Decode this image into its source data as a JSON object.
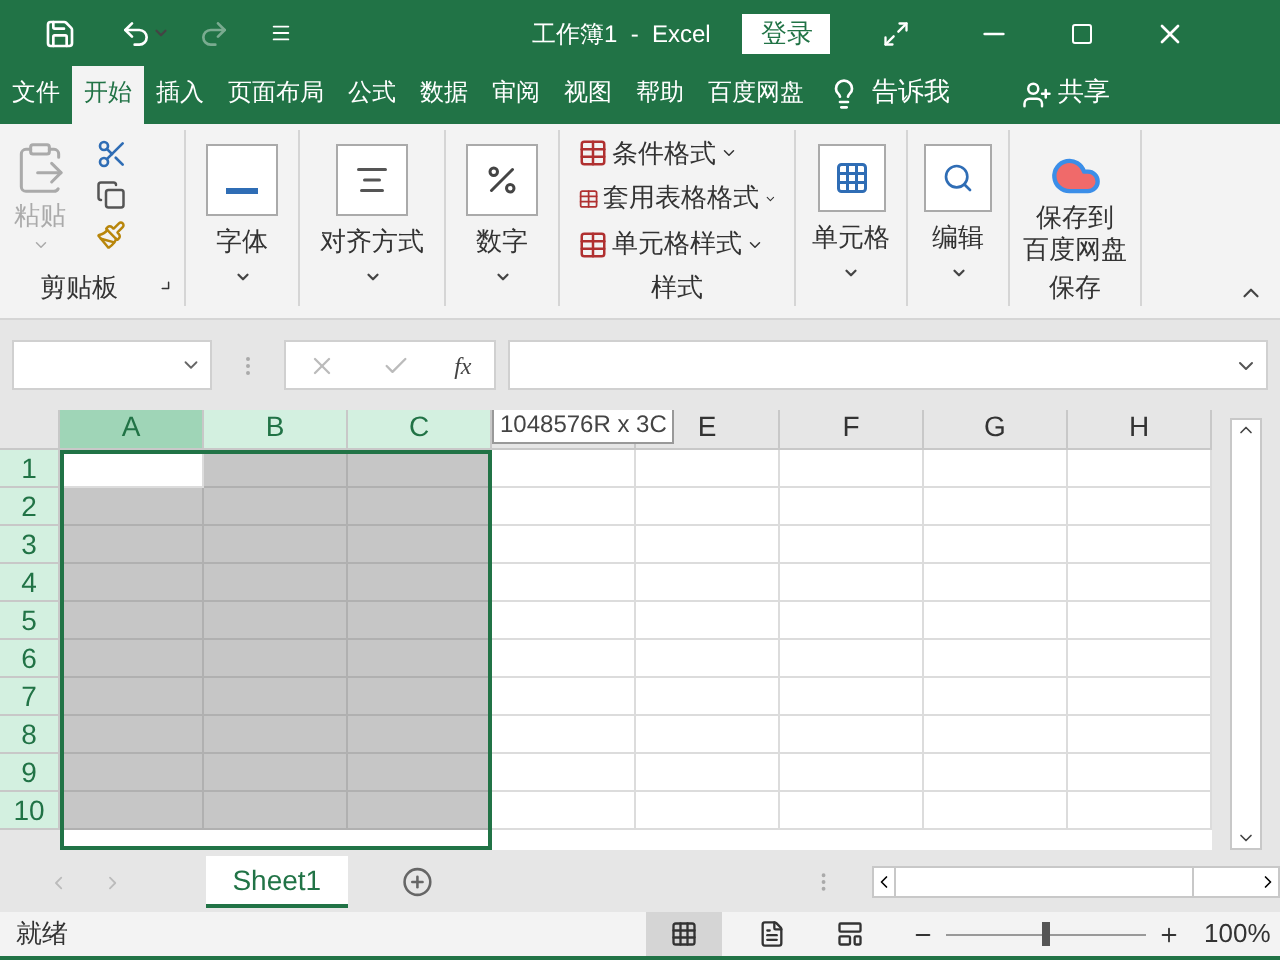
{
  "title_bar": {
    "title": "工作簿1  -  Excel",
    "login_button": "登录",
    "redo_disabled": true
  },
  "menu_tabs": [
    {
      "label": "文件",
      "selected": false
    },
    {
      "label": "开始",
      "selected": true
    },
    {
      "label": "插入",
      "selected": false
    },
    {
      "label": "页面布局",
      "selected": false
    },
    {
      "label": "公式",
      "selected": false
    },
    {
      "label": "数据",
      "selected": false
    },
    {
      "label": "审阅",
      "selected": false
    },
    {
      "label": "视图",
      "selected": false
    },
    {
      "label": "帮助",
      "selected": false
    },
    {
      "label": "百度网盘",
      "selected": false
    }
  ],
  "tell_me": "告诉我",
  "share": "共享",
  "ribbon": {
    "clipboard": {
      "paste": {
        "label": "粘贴",
        "disabled": true
      },
      "group_label": "剪贴板"
    },
    "big_groups": [
      {
        "kind": "font",
        "label": "字体"
      },
      {
        "kind": "align",
        "label": "对齐方式"
      },
      {
        "kind": "number",
        "label": "数字"
      }
    ],
    "styles": {
      "items": [
        "条件格式",
        "套用表格格式",
        "单元格样式"
      ],
      "group_label": "样式"
    },
    "cells": {
      "label": "单元格"
    },
    "editing": {
      "label": "编辑"
    },
    "save": {
      "label_1": "保存到",
      "label_2": "百度网盘",
      "group_label": "保存"
    }
  },
  "formula_bar": {
    "fx": "fx"
  },
  "tooltip": "1048576R x 3C",
  "columns": [
    {
      "label": "A",
      "selected": true,
      "active": true
    },
    {
      "label": "B",
      "selected": true,
      "active": false
    },
    {
      "label": "C",
      "selected": true,
      "active": false
    },
    {
      "selected": false,
      "active": false
    },
    {
      "label": "E",
      "selected": false,
      "active": false
    },
    {
      "label": "F",
      "selected": false,
      "active": false
    },
    {
      "label": "G",
      "selected": false,
      "active": false
    },
    {
      "label": "H",
      "selected": false,
      "active": false
    }
  ],
  "rows": [
    "1",
    "2",
    "3",
    "4",
    "5",
    "6",
    "7",
    "8",
    "9",
    "10"
  ],
  "sheet_tabs": [
    {
      "label": "Sheet1",
      "selected": true
    }
  ],
  "status_bar": {
    "status": "就绪",
    "zoom": "100%",
    "level": 0.5
  }
}
